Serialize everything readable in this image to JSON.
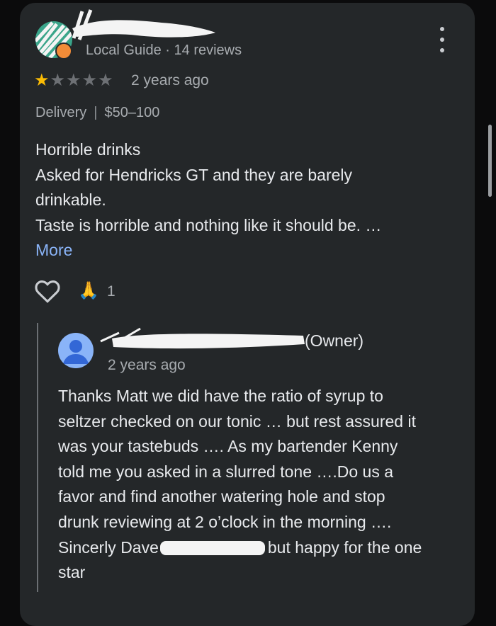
{
  "review": {
    "author_meta": "Local Guide · 14 reviews",
    "rating": 1,
    "rating_max": 5,
    "time": "2 years ago",
    "service_type": "Delivery",
    "separator": "|",
    "price_range": "$50–100",
    "text_lines": [
      "Horrible drinks",
      "Asked for Hendricks GT and they are barely",
      "drinkable.",
      "Taste is horrible and nothing like it should be. …"
    ],
    "more_label": "More",
    "reaction_emoji": "🙏",
    "reaction_count": "1"
  },
  "reply": {
    "owner_label": "(Owner)",
    "time": "2 years ago",
    "text_lines": [
      "Thanks Matt we did have the ratio of syrup to",
      "seltzer checked on our tonic … but rest assured it",
      "was your tastebuds …. As my bartender Kenny",
      "told me you asked in a slurred tone ….Do us a",
      "favor and find another watering hole and stop",
      "drunk reviewing at 2 o’clock in the morning ….",
      "Sincerly Dave",
      "star"
    ],
    "line7_tail": "but happy for the one"
  },
  "icons": {
    "kebab": "more-vertical-icon",
    "heart": "heart-outline-icon",
    "badge": "local-guide-badge-icon"
  },
  "colors": {
    "background": "#0b0b0c",
    "card": "#242729",
    "star_on": "#fbbc04",
    "star_off": "#6d7074",
    "link": "#8ab4f8",
    "muted_text": "#a8acb0"
  }
}
